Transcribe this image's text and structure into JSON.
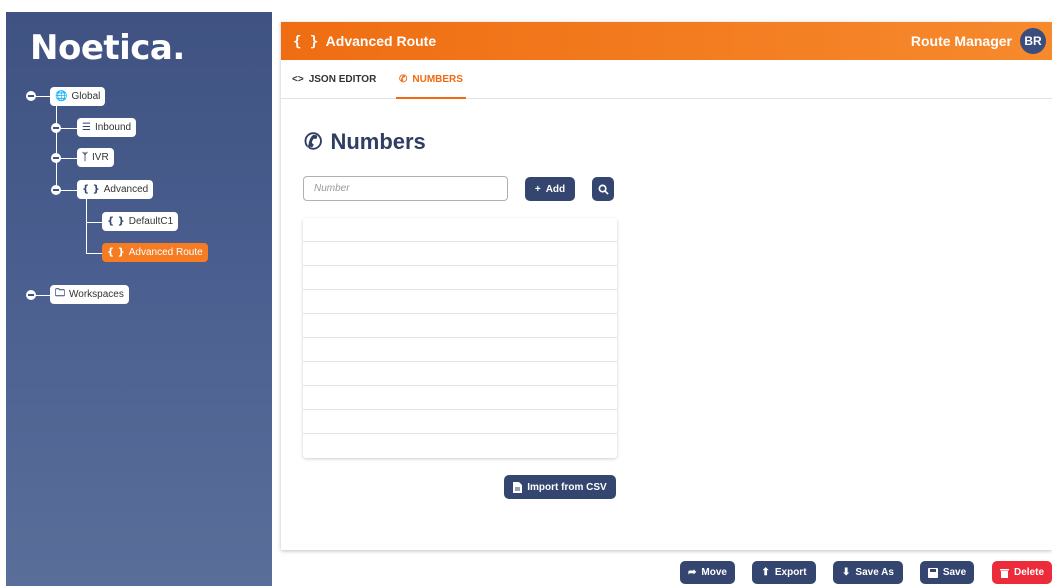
{
  "brand": {
    "logo_text": "Noetica."
  },
  "tree": {
    "global": "Global",
    "inbound": "Inbound",
    "ivr": "IVR",
    "advanced": "Advanced",
    "default_c1": "DefaultC1",
    "advanced_route": "Advanced Route",
    "workspaces": "Workspaces"
  },
  "header": {
    "title": "Advanced Route",
    "braces": "{ }",
    "app_name": "Route Manager",
    "avatar_initials": "BR"
  },
  "tabs": [
    {
      "label": "JSON EDITOR",
      "icon": "code-icon"
    },
    {
      "label": "NUMBERS",
      "icon": "phone-icon",
      "active": true
    }
  ],
  "numbers": {
    "title": "Numbers",
    "input_placeholder": "Number",
    "input_value": "",
    "add_label": "Add",
    "import_label": "Import from CSV"
  },
  "actions": {
    "move": "Move",
    "export": "Export",
    "save_as": "Save As",
    "save": "Save",
    "delete": "Delete"
  },
  "colors": {
    "accent": "#f57c22",
    "primary": "#34466f",
    "danger": "#ec2c3b",
    "sidebar": "#3f5282"
  }
}
